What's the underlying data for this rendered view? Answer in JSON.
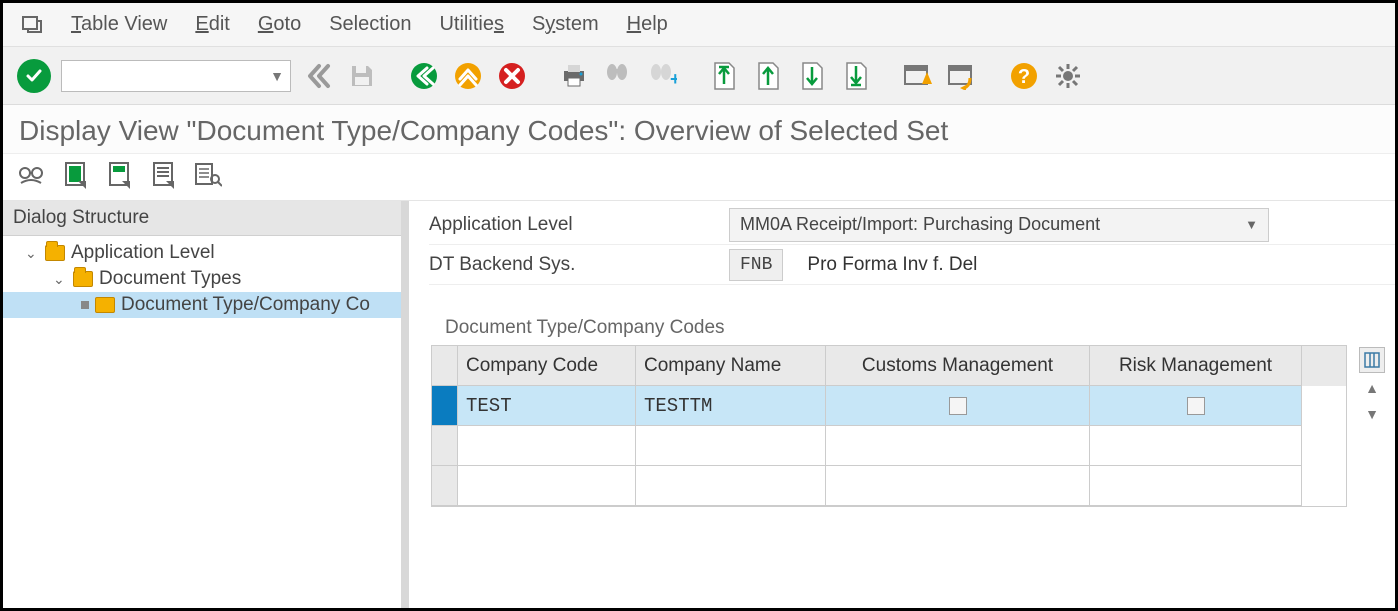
{
  "menu": {
    "items": [
      "Table View",
      "Edit",
      "Goto",
      "Selection",
      "Utilities",
      "System",
      "Help"
    ],
    "underlines": [
      "T",
      "E",
      "G",
      "",
      "",
      "",
      ""
    ]
  },
  "toolbar": {
    "tcode_value": ""
  },
  "page_title": "Display View \"Document Type/Company Codes\": Overview of Selected Set",
  "dialog_structure": {
    "header": "Dialog Structure",
    "nodes": [
      {
        "label": "Application Level",
        "level": 1,
        "expanded": true,
        "selected": false
      },
      {
        "label": "Document Types",
        "level": 2,
        "expanded": true,
        "selected": false
      },
      {
        "label": "Document Type/Company Co",
        "level": 3,
        "expanded": false,
        "selected": true
      }
    ]
  },
  "form": {
    "app_level_label": "Application Level",
    "app_level_value": "MM0A Receipt/Import: Purchasing Document",
    "dt_label": "DT Backend Sys.",
    "dt_value": "FNB",
    "dt_desc": "Pro Forma Inv f. Del"
  },
  "grid": {
    "title": "Document Type/Company Codes",
    "columns": [
      "Company Code",
      "Company Name",
      "Customs Management",
      "Risk Management"
    ],
    "rows": [
      {
        "company_code": "TEST",
        "company_name": "TESTTM",
        "customs": false,
        "risk": false
      }
    ]
  },
  "icons": {
    "ok": "ok-icon",
    "save": "save-icon",
    "back": "back-chevrons-icon",
    "firstpage": "first-page-icon",
    "up": "page-up-icon",
    "cancel": "cancel-icon",
    "print": "print-icon",
    "find": "find-icon",
    "findnext": "find-next-icon",
    "scrollfirst": "scroll-first-icon",
    "scrollprev": "scroll-prev-icon",
    "scrollnext": "scroll-next-icon",
    "scrolllast": "scroll-last-icon",
    "newmode": "new-session-icon",
    "shortcut": "shortcut-icon",
    "help": "help-icon",
    "customize": "customize-icon",
    "glasses": "display-change-icon",
    "selall": "select-all-icon",
    "selblk": "select-block-icon",
    "desall": "deselect-all-icon",
    "config": "table-settings-icon"
  }
}
